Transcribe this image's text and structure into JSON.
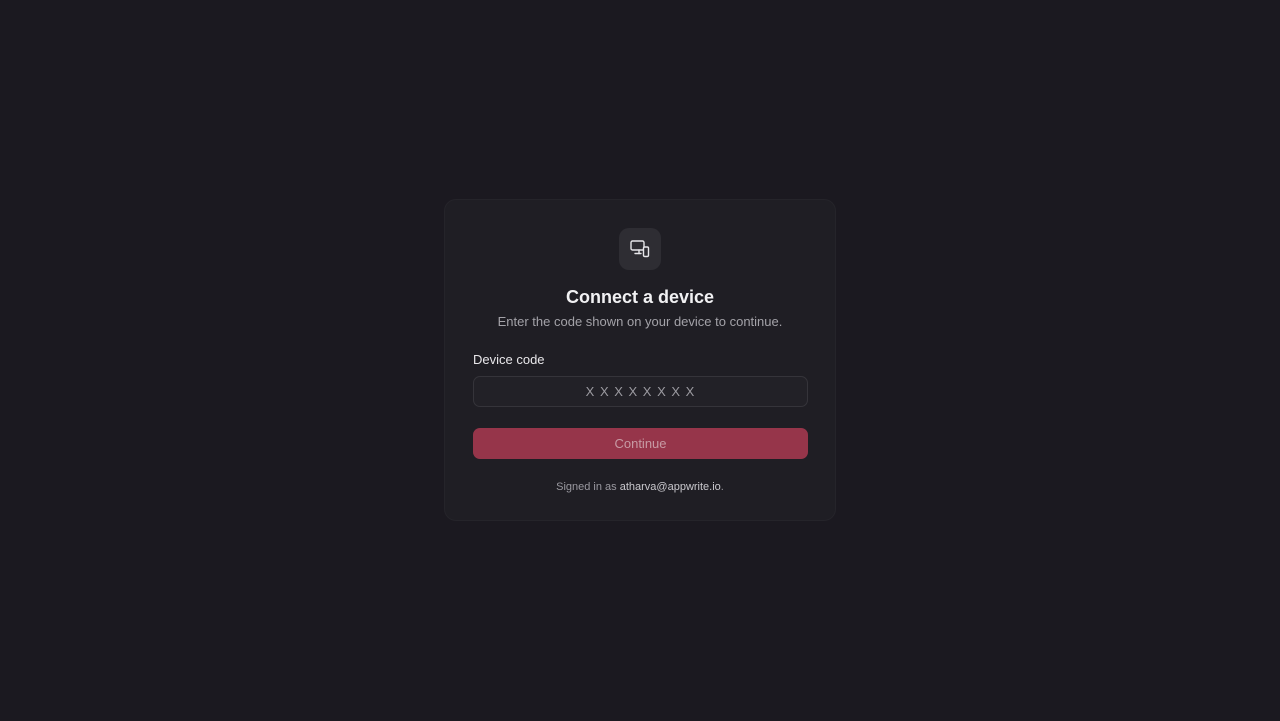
{
  "card": {
    "icon": "device-connect-icon",
    "title": "Connect a device",
    "subtitle": "Enter the code shown on your device to continue."
  },
  "form": {
    "label": "Device code",
    "placeholder": "X X X X X X X X",
    "value": "",
    "button_label": "Continue"
  },
  "footer": {
    "prefix": "Signed in as ",
    "email": "atharva@appwrite.io",
    "suffix": "."
  },
  "colors": {
    "background": "#1b1920",
    "card": "#1f1e24",
    "accent": "#96354a"
  }
}
